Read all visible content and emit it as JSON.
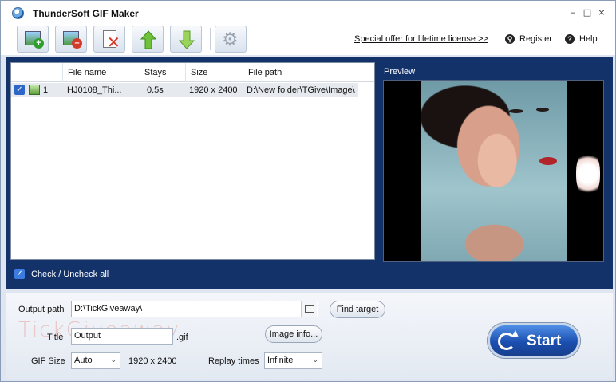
{
  "window": {
    "title": "ThunderSoft GIF Maker",
    "controls": [
      "–",
      "□",
      "×"
    ]
  },
  "toolbar": {
    "buttons": [
      "add-image",
      "remove-image",
      "clear-list",
      "move-up",
      "move-down",
      "settings"
    ],
    "special_offer": "Special offer for lifetime license >>",
    "register": "Register",
    "help": "Help"
  },
  "file_list": {
    "columns": [
      "File name",
      "Stays",
      "Size",
      "File path"
    ],
    "rows": [
      {
        "index": "1",
        "name": "HJ0108_Thi...",
        "stays": "0.5s",
        "size": "1920 x 2400",
        "path": "D:\\New folder\\TGive\\Image\\",
        "checked": true
      }
    ]
  },
  "check_all_label": "Check / Uncheck all",
  "preview_label": "Preview",
  "output": {
    "path_label": "Output path",
    "path_value": "D:\\TickGiveaway\\",
    "find_target": "Find target",
    "title_label": "Title",
    "title_value": "Output",
    "extension": ".gif",
    "image_info": "Image info...",
    "gif_size_label": "GIF Size",
    "gif_size_value": "Auto",
    "dimensions": "1920 x 2400",
    "replay_label": "Replay times",
    "replay_value": "Infinite"
  },
  "start_label": "Start",
  "watermark": "TickGiveaway",
  "colors": {
    "panel_blue": "#13326a",
    "start_blue": "#1b4fb0",
    "checkbox_blue": "#2c66c6"
  }
}
